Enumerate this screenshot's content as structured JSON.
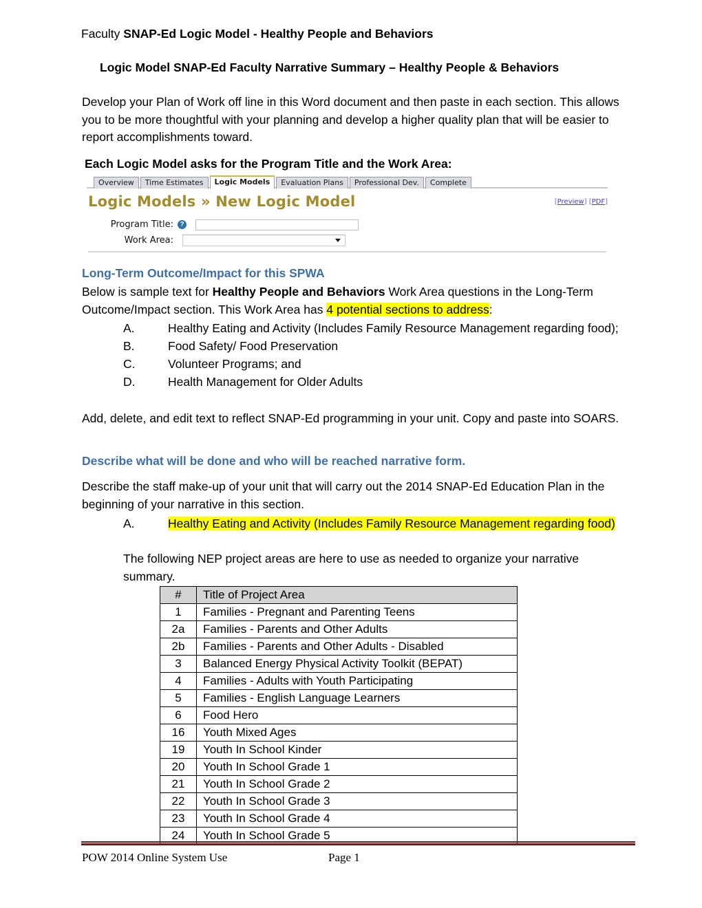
{
  "document": {
    "title_prefix": "Faculty ",
    "title_bold": "SNAP-Ed Logic Model - Healthy People and Behaviors",
    "subtitle": "Logic Model SNAP-Ed Faculty Narrative Summary – Healthy People & Behaviors",
    "intro_paragraph": "Develop your Plan of Work off line in this Word document and then paste in each section.  This allows you to be more thoughtful with your planning and develop a higher quality plan that will be easier to report accomplishments toward.",
    "asks_line": "Each Logic Model asks for the Program Title and the Work Area:"
  },
  "app_screenshot": {
    "tabs": [
      {
        "label": "Overview",
        "active": false
      },
      {
        "label": "Time Estimates",
        "active": false
      },
      {
        "label": "Logic Models",
        "active": true
      },
      {
        "label": "Evaluation Plans",
        "active": false
      },
      {
        "label": "Professional Dev.",
        "active": false
      },
      {
        "label": "Complete",
        "active": false
      }
    ],
    "heading": "Logic Models » New Logic Model",
    "heading_color": "#a48c2a",
    "links": [
      {
        "label": "Preview"
      },
      {
        "label": "PDF"
      }
    ],
    "link_color": "#3c3cc8",
    "form": {
      "program_title_label": "Program Title:",
      "program_title_value": "",
      "program_title_help_icon": "question-mark-help-icon",
      "work_area_label": "Work Area:",
      "work_area_value": "",
      "work_area_arrow_icon": "chevron-down-icon"
    },
    "active_tab_accent": "#d5b83c"
  },
  "long_term_section": {
    "heading": "Long-Term Outcome/Impact for this SPWA",
    "heading_color": "#3f6fab",
    "body_part1": "Below is sample text for ",
    "body_bold": "Healthy People and Behaviors",
    "body_part2": " Work Area questions in the Long-Term Outcome/Impact section.  This Work Area has ",
    "body_highlight": "4 potential sections to address",
    "body_part3": ":",
    "highlight_color": "#ffff00",
    "items": [
      {
        "mark": "A.",
        "text": "Healthy Eating and Activity (Includes Family Resource Management regarding food);"
      },
      {
        "mark": "B.",
        "text": "Food Safety/ Food Preservation"
      },
      {
        "mark": "C.",
        "text": "Volunteer Programs; and"
      },
      {
        "mark": "D.",
        "text": "Health Management for Older Adults"
      }
    ],
    "closing_paragraph": "Add, delete, and edit text to reflect SNAP-Ed programming in your unit.  Copy and paste into SOARS."
  },
  "describe_section": {
    "heading": "Describe what will be done and who will be reached narrative form.",
    "heading_color": "#3f6fab",
    "staff_paragraph": "Describe the staff make-up of your unit that will carry out the 2014 SNAP-Ed Education Plan in the beginning of your narrative in this section.",
    "item_a_mark": "A.",
    "item_a_highlighted": "Healthy Eating and Activity (Includes Family Resource Management regarding food)",
    "nep_paragraph": "The following NEP project areas are here to use as needed to organize your narrative summary."
  },
  "project_table": {
    "headers": [
      "#",
      "Title  of Project Area"
    ],
    "header_bg": "#d4d4d4",
    "rows": [
      {
        "num": "1",
        "title": "Families - Pregnant and Parenting Teens"
      },
      {
        "num": "2a",
        "title": "Families - Parents and Other Adults"
      },
      {
        "num": "2b",
        "title": "Families - Parents and Other Adults - Disabled"
      },
      {
        "num": "3",
        "title": "Balanced Energy Physical Activity Toolkit (BEPAT)"
      },
      {
        "num": "4",
        "title": "Families - Adults with Youth Participating"
      },
      {
        "num": "5",
        "title": "Families - English Language Learners"
      },
      {
        "num": "6",
        "title": "Food Hero"
      },
      {
        "num": "16",
        "title": "Youth Mixed Ages"
      },
      {
        "num": "19",
        "title": "Youth In School Kinder"
      },
      {
        "num": "20",
        "title": "Youth In School Grade 1"
      },
      {
        "num": "21",
        "title": "Youth In School Grade 2"
      },
      {
        "num": "22",
        "title": "Youth In School Grade 3"
      },
      {
        "num": "23",
        "title": "Youth In School Grade 4"
      },
      {
        "num": "24",
        "title": "Youth In School Grade 5"
      }
    ]
  },
  "footer": {
    "left_text": "POW 2014 Online System Use",
    "page_text": "Page 1",
    "rule_color": "#6b1b1b"
  }
}
